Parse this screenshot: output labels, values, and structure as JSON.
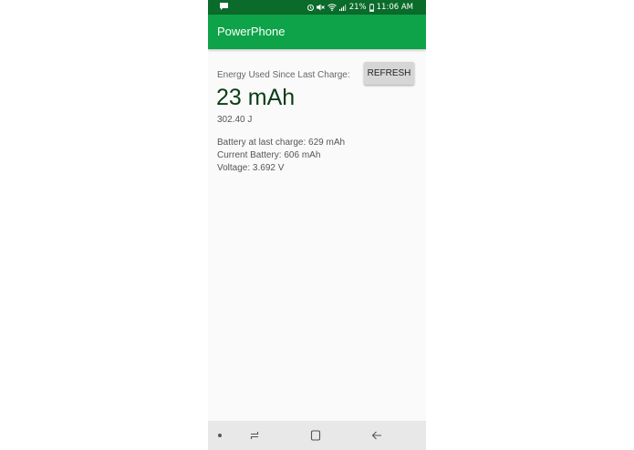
{
  "status_bar": {
    "battery_percent": "21%",
    "time": "11:06 AM",
    "icons": [
      "message-icon",
      "alarm-icon",
      "mute-icon",
      "wifi-icon",
      "signal-icon",
      "battery-icon"
    ]
  },
  "app_bar": {
    "title": "PowerPhone"
  },
  "main": {
    "energy_label": "Energy Used Since Last Charge:",
    "energy_value": "23 mAh",
    "joules": "302.40 J",
    "refresh_label": "REFRESH",
    "battery_last_charge": "Battery at last charge: 629 mAh",
    "current_battery": "Current Battery: 606 mAh",
    "voltage": "Voltage: 3.692 V"
  },
  "nav_bar": {
    "icons": [
      "dot-icon",
      "recents-icon",
      "home-icon",
      "back-icon"
    ]
  },
  "colors": {
    "status_bar": "#0a6b2a",
    "app_bar": "#0ea348",
    "energy_value": "#0b3d17",
    "background": "#fafafa",
    "nav_bar": "#e8e8e8"
  }
}
